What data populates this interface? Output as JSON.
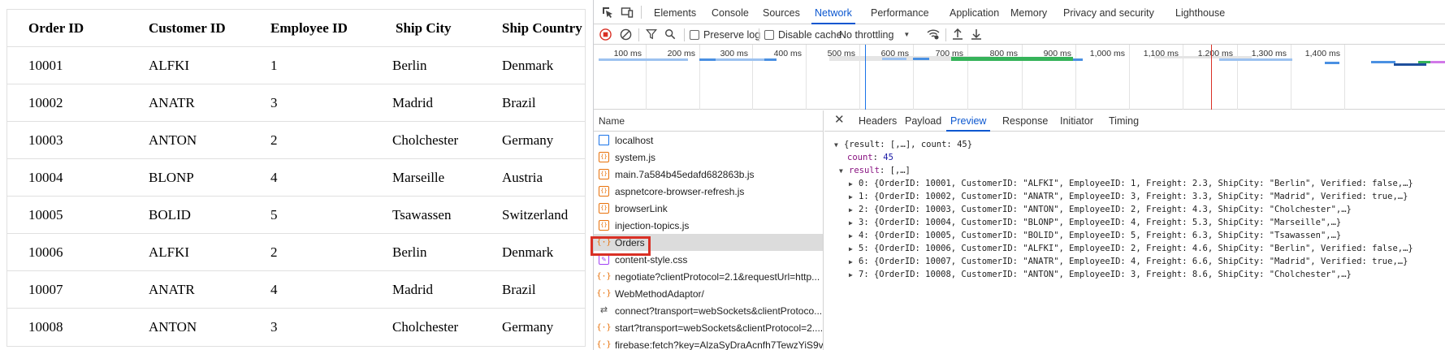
{
  "grid": {
    "columns": [
      "Order ID",
      "Customer ID",
      "Employee ID",
      "Ship City",
      "Ship Country"
    ],
    "rows": [
      [
        "10001",
        "ALFKI",
        "1",
        "Berlin",
        "Denmark"
      ],
      [
        "10002",
        "ANATR",
        "3",
        "Madrid",
        "Brazil"
      ],
      [
        "10003",
        "ANTON",
        "2",
        "Cholchester",
        "Germany"
      ],
      [
        "10004",
        "BLONP",
        "4",
        "Marseille",
        "Austria"
      ],
      [
        "10005",
        "BOLID",
        "5",
        "Tsawassen",
        "Switzerland"
      ],
      [
        "10006",
        "ALFKI",
        "2",
        "Berlin",
        "Denmark"
      ],
      [
        "10007",
        "ANATR",
        "4",
        "Madrid",
        "Brazil"
      ],
      [
        "10008",
        "ANTON",
        "3",
        "Cholchester",
        "Germany"
      ]
    ]
  },
  "devtools": {
    "tabs": [
      "Elements",
      "Console",
      "Sources",
      "Network",
      "Performance",
      "Application",
      "Memory",
      "Privacy and security",
      "Lighthouse"
    ],
    "active_tab": "Network",
    "toolbar": {
      "preserve_log": "Preserve log",
      "disable_cache": "Disable cache",
      "throttling": "No throttling"
    },
    "timeline_ticks": [
      "100 ms",
      "200 ms",
      "300 ms",
      "400 ms",
      "500 ms",
      "600 ms",
      "700 ms",
      "800 ms",
      "900 ms",
      "1,000 ms",
      "1,100 ms",
      "1,200 ms",
      "1,300 ms",
      "1,400 ms"
    ],
    "name_header": "Name",
    "requests": [
      {
        "name": "localhost",
        "icon": "doc"
      },
      {
        "name": "system.js",
        "icon": "js"
      },
      {
        "name": "main.7a584b45edafd682863b.js",
        "icon": "js"
      },
      {
        "name": "aspnetcore-browser-refresh.js",
        "icon": "js"
      },
      {
        "name": "browserLink",
        "icon": "js"
      },
      {
        "name": "injection-topics.js",
        "icon": "js"
      },
      {
        "name": "Orders",
        "icon": "xhr"
      },
      {
        "name": "content-style.css",
        "icon": "css"
      },
      {
        "name": "negotiate?clientProtocol=2.1&requestUrl=http...",
        "icon": "xhr"
      },
      {
        "name": "WebMethodAdaptor/",
        "icon": "xhr"
      },
      {
        "name": "connect?transport=webSockets&clientProtoco...",
        "icon": "ws"
      },
      {
        "name": "start?transport=webSockets&clientProtocol=2....",
        "icon": "xhr"
      },
      {
        "name": "firebase:fetch?key=AlzaSyDraAcnfh7TewzYiS9v...",
        "icon": "xhr"
      }
    ],
    "selected_request": "Orders",
    "detail_tabs": [
      "Headers",
      "Payload",
      "Preview",
      "Response",
      "Initiator",
      "Timing"
    ],
    "active_detail_tab": "Preview",
    "preview": {
      "root": "{result: [,…], count: 45}",
      "count_key": "count",
      "count_value": "45",
      "result_key": "result",
      "result_summary": "[,…]",
      "items": [
        "0: {OrderID: 10001, CustomerID: \"ALFKI\", EmployeeID: 1, Freight: 2.3, ShipCity: \"Berlin\", Verified: false,…}",
        "1: {OrderID: 10002, CustomerID: \"ANATR\", EmployeeID: 3, Freight: 3.3, ShipCity: \"Madrid\", Verified: true,…}",
        "2: {OrderID: 10003, CustomerID: \"ANTON\", EmployeeID: 2, Freight: 4.3, ShipCity: \"Cholchester\",…}",
        "3: {OrderID: 10004, CustomerID: \"BLONP\", EmployeeID: 4, Freight: 5.3, ShipCity: \"Marseille\",…}",
        "4: {OrderID: 10005, CustomerID: \"BOLID\", EmployeeID: 5, Freight: 6.3, ShipCity: \"Tsawassen\",…}",
        "5: {OrderID: 10006, CustomerID: \"ALFKI\", EmployeeID: 2, Freight: 4.6, ShipCity: \"Berlin\", Verified: false,…}",
        "6: {OrderID: 10007, CustomerID: \"ANATR\", EmployeeID: 4, Freight: 6.6, ShipCity: \"Madrid\", Verified: true,…}",
        "7: {OrderID: 10008, CustomerID: \"ANTON\", EmployeeID: 3, Freight: 8.6, ShipCity: \"Cholchester\",…}"
      ]
    },
    "colors": {
      "accent": "#0b57d0",
      "highlight": "#d93025",
      "record": "#d93025"
    }
  }
}
